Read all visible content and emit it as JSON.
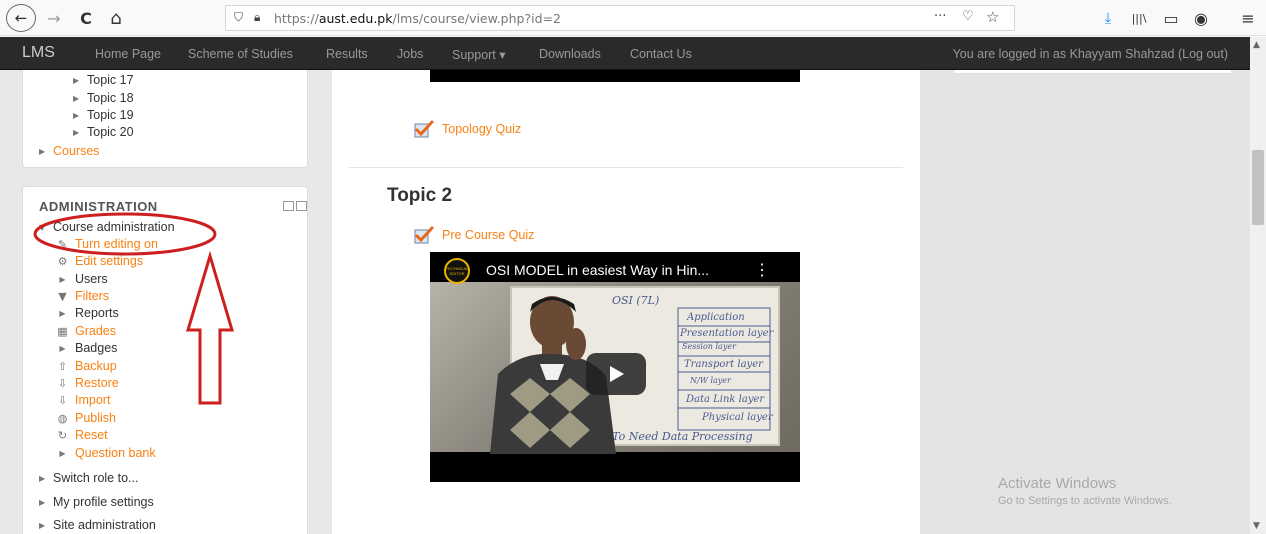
{
  "browser": {
    "back_icon": "←",
    "forward_icon": "→",
    "reload_icon": "C",
    "home_icon": "⌂",
    "url_prefix": "https://",
    "url_domain": "aust.edu.pk",
    "url_path": "/lms/course/view.php?id=2",
    "menu_icons": [
      "···",
      "♡",
      "☆"
    ],
    "toolbar_icons": [
      "⤓",
      "|||\\",
      "▭",
      "◉",
      "≡"
    ]
  },
  "navbar": {
    "brand": "LMS",
    "items": [
      "Home Page",
      "Scheme of Studies",
      "Results",
      "Jobs",
      "Support ▾",
      "Downloads",
      "Contact Us"
    ],
    "login_text": "You are logged in as Khayyam Shahzad (Log out)"
  },
  "sidebar": {
    "topics": [
      "Topic 17",
      "Topic 18",
      "Topic 19",
      "Topic 20"
    ],
    "courses_label": "Courses",
    "admin_title": "ADMINISTRATION",
    "course_admin_label": "Course administration",
    "admin_items": [
      {
        "label": "Turn editing on",
        "icon": "pencil-icon",
        "link": true
      },
      {
        "label": "Edit settings",
        "icon": "gear-icon",
        "link": true
      },
      {
        "label": "Users",
        "icon": "arrow",
        "link": false
      },
      {
        "label": "Filters",
        "icon": "filter-icon",
        "link": true
      },
      {
        "label": "Reports",
        "icon": "arrow",
        "link": false
      },
      {
        "label": "Grades",
        "icon": "table-icon",
        "link": true
      },
      {
        "label": "Badges",
        "icon": "arrow",
        "link": false
      },
      {
        "label": "Backup",
        "icon": "upload-icon",
        "link": true
      },
      {
        "label": "Restore",
        "icon": "download-icon",
        "link": true
      },
      {
        "label": "Import",
        "icon": "download-icon",
        "link": true
      },
      {
        "label": "Publish",
        "icon": "globe-icon",
        "link": true
      },
      {
        "label": "Reset",
        "icon": "reset-icon",
        "link": true
      },
      {
        "label": "Question bank",
        "icon": "arrow",
        "link": true
      }
    ],
    "bottom_items": [
      "Switch role to...",
      "My profile settings",
      "Site administration"
    ]
  },
  "main": {
    "topology_quiz": "Topology Quiz",
    "topic_title": "Topic 2",
    "pre_course_quiz": "Pre Course Quiz",
    "video_title": "OSI MODEL in easiest Way in Hin...",
    "video_channel": "TECHNICAL EDITOR",
    "whiteboard_lines": [
      "OSI (7L)",
      "Application",
      "Presentation layer",
      "Session layer",
      "Transport layer",
      "N/W layer",
      "Data Link layer",
      "Physical layer",
      "Seems To Need Data Processing"
    ]
  },
  "watermark": {
    "line1": "Activate Windows",
    "line2": "Go to Settings to activate Windows."
  },
  "colors": {
    "link": "#f98012",
    "navbar": "#2a2a2a",
    "annotation": "#cc1f1f"
  }
}
